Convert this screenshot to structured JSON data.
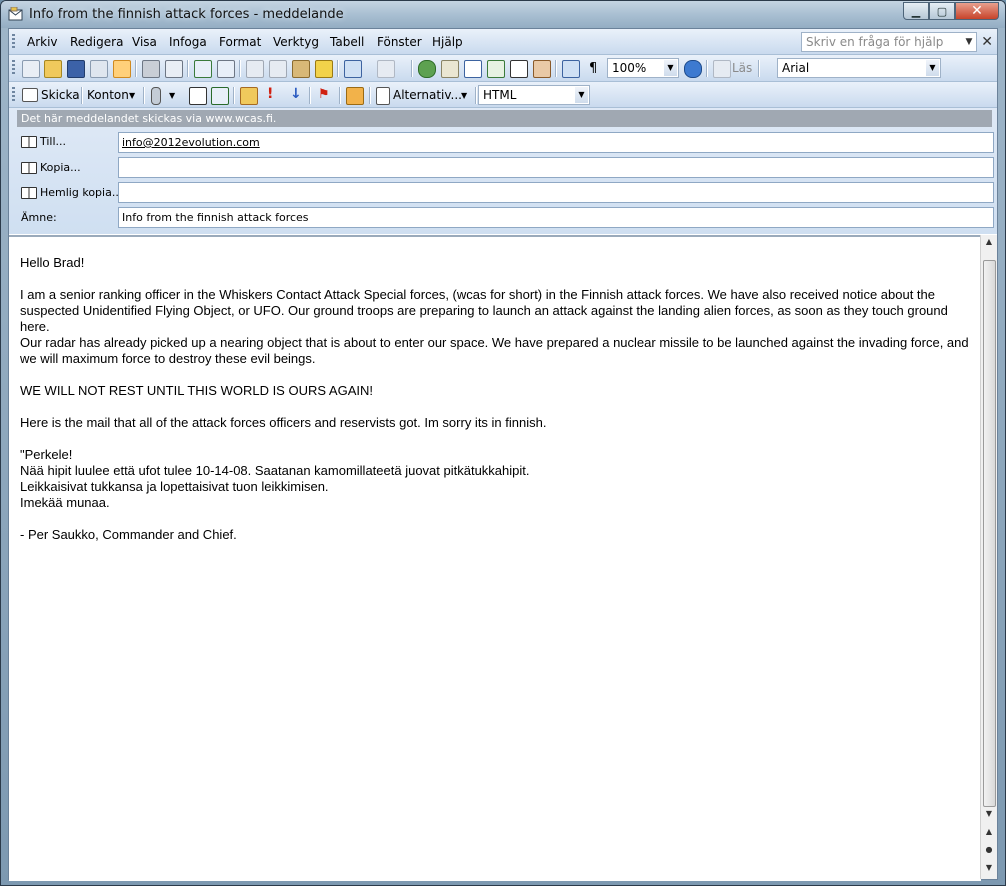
{
  "window": {
    "title": "Info from the finnish attack forces - meddelande",
    "minimize": "▁",
    "maximize": "▢",
    "close": "✕"
  },
  "menubar": {
    "items": [
      {
        "label": "Arkiv"
      },
      {
        "label": "Redigera"
      },
      {
        "label": "Visa"
      },
      {
        "label": "Infoga"
      },
      {
        "label": "Format"
      },
      {
        "label": "Verktyg"
      },
      {
        "label": "Tabell"
      },
      {
        "label": "Fönster"
      },
      {
        "label": "Hjälp"
      }
    ],
    "help_placeholder": "Skriv en fråga för hjälp",
    "doc_close": "✕"
  },
  "toolbar1": {
    "zoom": "100%",
    "read_label": "Läs",
    "font": "Arial",
    "pilcrow": "¶"
  },
  "toolbar2": {
    "send_label": "Skicka",
    "accounts_label": "Konton",
    "options_label": "Alternativ...",
    "format": "HTML"
  },
  "infobar": {
    "text": "Det här meddelandet skickas via www.wcas.fi."
  },
  "header": {
    "to_label": "Till...",
    "to_value": "info@2012evolution.com",
    "cc_label": "Kopia...",
    "cc_value": "",
    "bcc_label": "Hemlig kopia...",
    "bcc_value": "",
    "subject_label": "Ämne:",
    "subject_value": "Info from the finnish attack forces"
  },
  "message": {
    "greeting": "Hello Brad!",
    "para1": "I am a senior ranking officer in the Whiskers Contact Attack Special forces, (wcas for short) in the Finnish attack forces. We have also received notice about the suspected Unidentified Flying Object, or UFO. Our ground troops are preparing to launch an attack against the landing alien forces, as soon as they touch ground here.",
    "para2": "Our radar has already picked up a nearing object that is about to enter our space. We have prepared a nuclear missile to be launched against the invading force, and we will maximum force to destroy these evil beings.",
    "shout": "WE WILL NOT REST UNTIL THIS WORLD IS OURS AGAIN!",
    "intro": "Here is the mail that all of the attack forces officers and reservists got. Im sorry its in finnish.",
    "quote1": "\"Perkele!",
    "quote2": "Nää hipit luulee että ufot tulee 10-14-08. Saatanan kamomillateetä juovat pitkätukkahipit.",
    "quote3": "Leikkaisivat tukkansa ja lopettaisivat tuon leikkimisen.",
    "quote4": "Imekää munaa.",
    "signature": "- Per Saukko, Commander and Chief."
  }
}
